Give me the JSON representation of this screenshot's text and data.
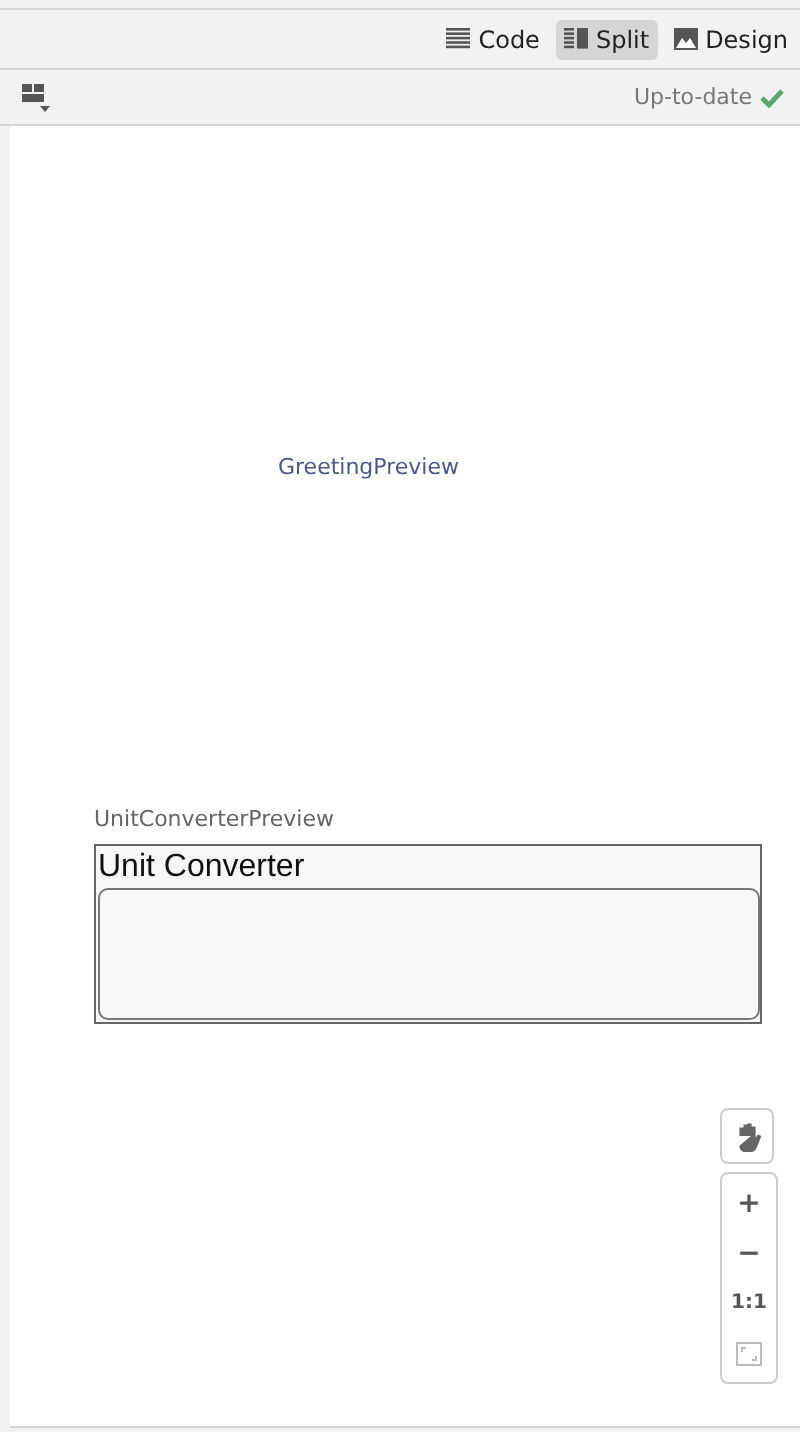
{
  "view_modes": [
    {
      "label": "Code",
      "kind": "lines",
      "selected": false
    },
    {
      "label": "Split",
      "kind": "split",
      "selected": true
    },
    {
      "label": "Design",
      "kind": "image",
      "selected": false
    }
  ],
  "status": {
    "label": "Up-to-date",
    "ok": true
  },
  "previews": [
    {
      "kind": "empty",
      "name": "GreetingPreview"
    },
    {
      "kind": "component",
      "name": "UnitConverterPreview",
      "title": "Unit Converter"
    }
  ],
  "zoom_controls": [
    {
      "kind": "text",
      "label": "+",
      "disabled": false
    },
    {
      "kind": "text",
      "label": "−",
      "disabled": false
    },
    {
      "kind": "text",
      "label": "1:1",
      "disabled": false
    },
    {
      "kind": "fit",
      "disabled": true
    }
  ]
}
